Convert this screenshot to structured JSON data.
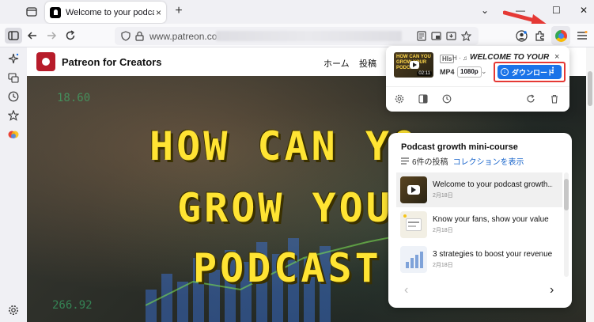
{
  "browser": {
    "tab": {
      "title": "Welcome to your podcast grow",
      "close": "×"
    },
    "new_tab": "+",
    "window_controls": {
      "minimize": "—",
      "maximize": "☐",
      "close": "✕"
    },
    "url": {
      "visible": "www.patreon.com/"
    }
  },
  "site": {
    "title": "Patreon for Creators",
    "nav": [
      "ホーム",
      "投稿"
    ]
  },
  "video": {
    "lines": [
      "HOW CAN YO",
      "GROW YOU",
      "PODCAST"
    ],
    "stock_numbers": [
      "18.60",
      "266.92"
    ]
  },
  "extension_popup": {
    "thumb_text": "HOW CAN YOU GROW YOUR PODCAST",
    "thumb_duration": "02:11",
    "tag_hls": "HIs",
    "tag_sep": "H · ♫",
    "title": "WELCOME TO YOUR PO...",
    "close": "×",
    "format": "MP4",
    "resolution": "1080p",
    "download_label": "ダウンロード",
    "accent_color": "#1a73e8",
    "highlight_color": "#e53935"
  },
  "course": {
    "title": "Podcast growth mini-course",
    "post_count": "6件の投稿",
    "collection_link": "コレクションを表示",
    "items": [
      {
        "title": "Welcome to your podcast growth...",
        "date": "2月18日"
      },
      {
        "title": "Know your fans, show your value",
        "date": "2月18日"
      },
      {
        "title": "3 strategies to boost your revenue",
        "date": "2月18日"
      }
    ],
    "prev": "‹",
    "next": "›"
  }
}
